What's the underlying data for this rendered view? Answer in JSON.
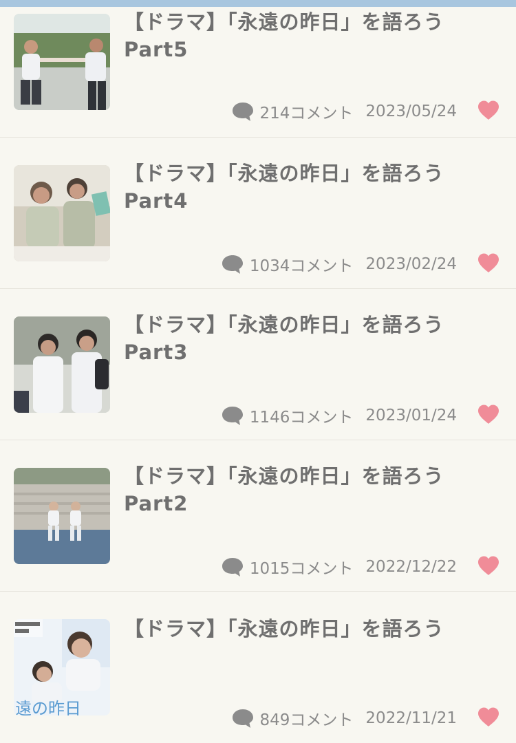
{
  "threads": [
    {
      "title_line1": "【ドラマ】「永遠の昨日」を語ろう",
      "title_line2": "Part5",
      "comment_count": "214コメント",
      "date": "2023/05/24"
    },
    {
      "title_line1": "【ドラマ】「永遠の昨日」を語ろう",
      "title_line2": "Part4",
      "comment_count": "1034コメント",
      "date": "2023/02/24"
    },
    {
      "title_line1": "【ドラマ】「永遠の昨日」を語ろう",
      "title_line2": "Part3",
      "comment_count": "1146コメント",
      "date": "2023/01/24"
    },
    {
      "title_line1": "【ドラマ】「永遠の昨日」を語ろう",
      "title_line2": "Part2",
      "comment_count": "1015コメント",
      "date": "2022/12/22"
    },
    {
      "title_line1": "【ドラマ】「永遠の昨日」を語ろう",
      "title_line2": "",
      "comment_count": "849コメント",
      "date": "2022/11/21"
    }
  ],
  "icons": {
    "comment": "comment-icon",
    "favorite": "heart-icon"
  },
  "colors": {
    "top_bar": "#a8c6df",
    "background": "#f8f7f1",
    "title": "#6f6f6f",
    "meta": "#8b8b8b",
    "heart": "#f08c98"
  }
}
